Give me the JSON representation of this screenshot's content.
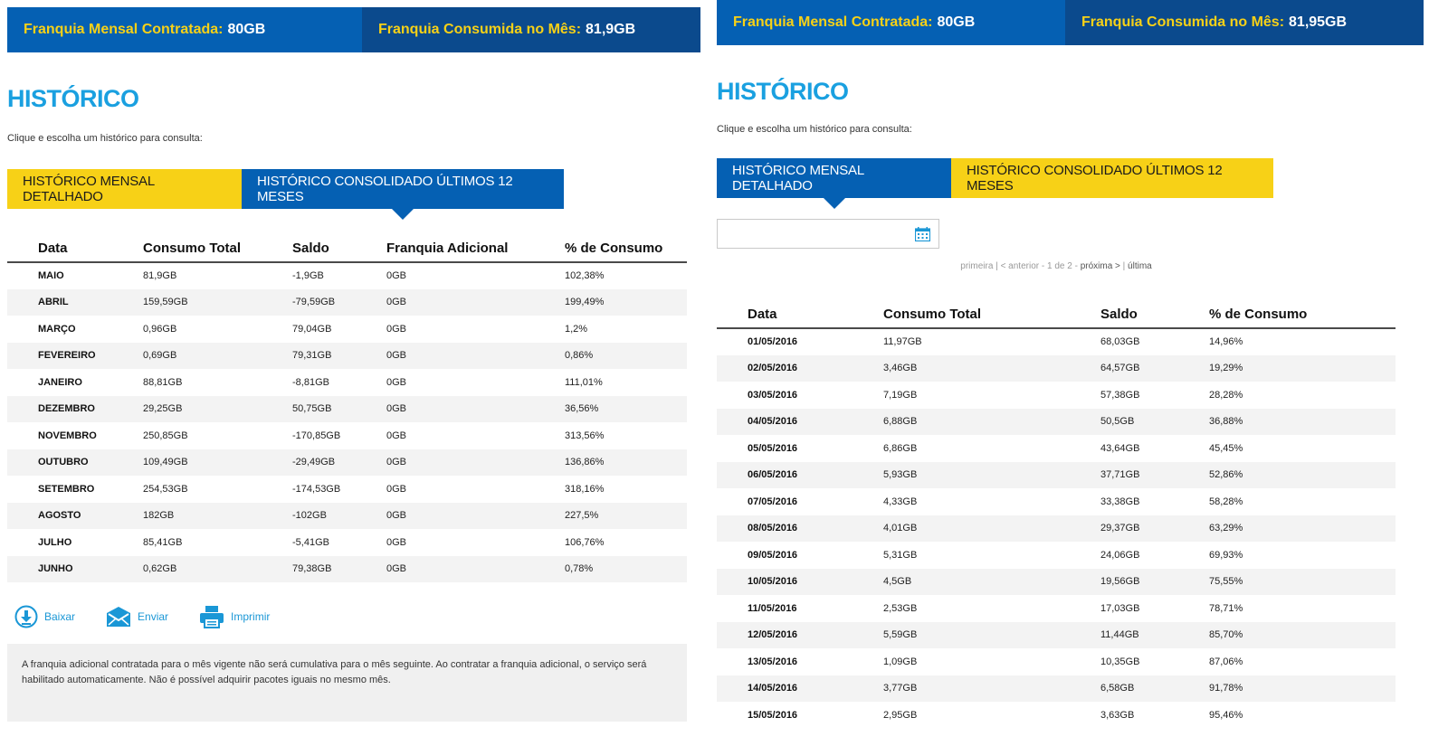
{
  "left": {
    "franchise": {
      "contracted_label": "Franquia Mensal Contratada:",
      "contracted_value": "80GB",
      "consumed_label": "Franquia Consumida no Mês:",
      "consumed_value": "81,9GB"
    },
    "title": "HISTÓRICO",
    "subtitle": "Clique e escolha um histórico para consulta:",
    "tabs": {
      "monthly": "HISTÓRICO MENSAL DETALHADO",
      "consolidated": "HISTÓRICO CONSOLIDADO ÚLTIMOS 12 MESES"
    },
    "table": {
      "headers": [
        "Data",
        "Consumo Total",
        "Saldo",
        "Franquia Adicional",
        "% de Consumo"
      ],
      "rows": [
        [
          "MAIO",
          "81,9GB",
          "-1,9GB",
          "0GB",
          "102,38%"
        ],
        [
          "ABRIL",
          "159,59GB",
          "-79,59GB",
          "0GB",
          "199,49%"
        ],
        [
          "MARÇO",
          "0,96GB",
          "79,04GB",
          "0GB",
          "1,2%"
        ],
        [
          "FEVEREIRO",
          "0,69GB",
          "79,31GB",
          "0GB",
          "0,86%"
        ],
        [
          "JANEIRO",
          "88,81GB",
          "-8,81GB",
          "0GB",
          "111,01%"
        ],
        [
          "DEZEMBRO",
          "29,25GB",
          "50,75GB",
          "0GB",
          "36,56%"
        ],
        [
          "NOVEMBRO",
          "250,85GB",
          "-170,85GB",
          "0GB",
          "313,56%"
        ],
        [
          "OUTUBRO",
          "109,49GB",
          "-29,49GB",
          "0GB",
          "136,86%"
        ],
        [
          "SETEMBRO",
          "254,53GB",
          "-174,53GB",
          "0GB",
          "318,16%"
        ],
        [
          "AGOSTO",
          "182GB",
          "-102GB",
          "0GB",
          "227,5%"
        ],
        [
          "JULHO",
          "85,41GB",
          "-5,41GB",
          "0GB",
          "106,76%"
        ],
        [
          "JUNHO",
          "0,62GB",
          "79,38GB",
          "0GB",
          "0,78%"
        ]
      ]
    },
    "actions": {
      "download": "Baixar",
      "send": "Enviar",
      "print": "Imprimir"
    },
    "notice": "A franquia adicional contratada para o mês vigente não será cumulativa para o mês seguinte. Ao contratar a franquia adicional, o serviço será habilitado automaticamente. Não é possível adquirir pacotes iguais no mesmo mês."
  },
  "right": {
    "franchise": {
      "contracted_label": "Franquia Mensal Contratada:",
      "contracted_value": "80GB",
      "consumed_label": "Franquia Consumida no Mês:",
      "consumed_value": "81,95GB"
    },
    "title": "HISTÓRICO",
    "subtitle": "Clique e escolha um histórico para consulta:",
    "tabs": {
      "monthly": "HISTÓRICO MENSAL DETALHADO",
      "consolidated": "HISTÓRICO CONSOLIDADO ÚLTIMOS 12 MESES"
    },
    "date_input": {
      "value": "",
      "placeholder": ""
    },
    "pagination": {
      "first": "primeira",
      "sep1": " | ",
      "prev": "< anterior",
      "sep2": " - ",
      "page": "1 de 2",
      "sep3": " - ",
      "next": "próxima >",
      "sep4": " | ",
      "last": "última"
    },
    "table": {
      "headers": [
        "Data",
        "Consumo Total",
        "Saldo",
        "% de Consumo"
      ],
      "rows": [
        [
          "01/05/2016",
          "11,97GB",
          "68,03GB",
          "14,96%"
        ],
        [
          "02/05/2016",
          "3,46GB",
          "64,57GB",
          "19,29%"
        ],
        [
          "03/05/2016",
          "7,19GB",
          "57,38GB",
          "28,28%"
        ],
        [
          "04/05/2016",
          "6,88GB",
          "50,5GB",
          "36,88%"
        ],
        [
          "05/05/2016",
          "6,86GB",
          "43,64GB",
          "45,45%"
        ],
        [
          "06/05/2016",
          "5,93GB",
          "37,71GB",
          "52,86%"
        ],
        [
          "07/05/2016",
          "4,33GB",
          "33,38GB",
          "58,28%"
        ],
        [
          "08/05/2016",
          "4,01GB",
          "29,37GB",
          "63,29%"
        ],
        [
          "09/05/2016",
          "5,31GB",
          "24,06GB",
          "69,93%"
        ],
        [
          "10/05/2016",
          "4,5GB",
          "19,56GB",
          "75,55%"
        ],
        [
          "11/05/2016",
          "2,53GB",
          "17,03GB",
          "78,71%"
        ],
        [
          "12/05/2016",
          "5,59GB",
          "11,44GB",
          "85,70%"
        ],
        [
          "13/05/2016",
          "1,09GB",
          "10,35GB",
          "87,06%"
        ],
        [
          "14/05/2016",
          "3,77GB",
          "6,58GB",
          "91,78%"
        ],
        [
          "15/05/2016",
          "2,95GB",
          "3,63GB",
          "95,46%"
        ]
      ]
    }
  },
  "colors": {
    "blue": "#0560b3",
    "dark_blue": "#0b4a8d",
    "yellow": "#f7d117",
    "title_cyan": "#1aa0e0",
    "link": "#1a97d6"
  }
}
